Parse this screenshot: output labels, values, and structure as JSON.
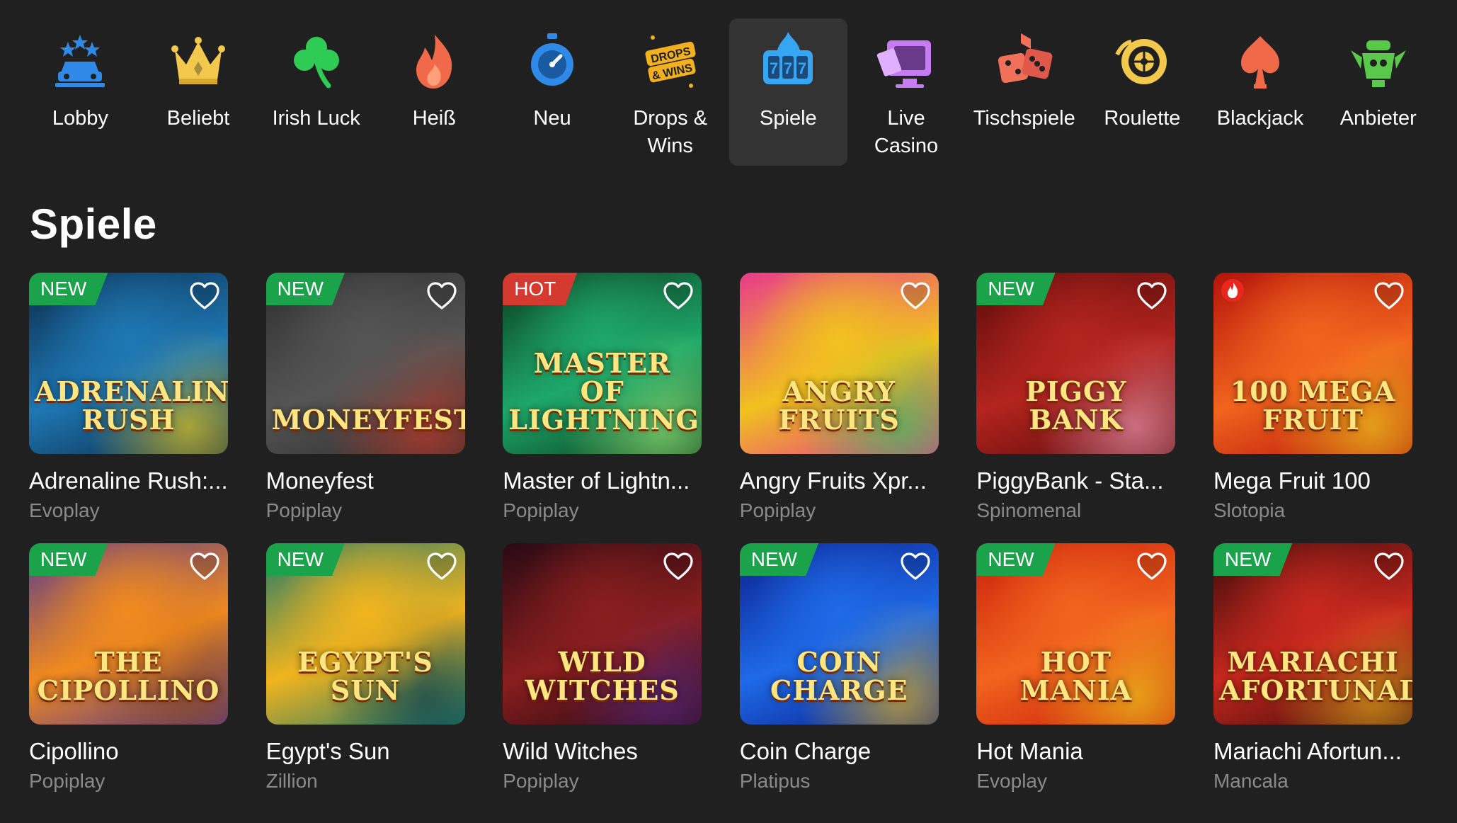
{
  "nav": {
    "items": [
      {
        "label": "Lobby",
        "icon": "lobby-car-icon",
        "color": "#2e8ae6"
      },
      {
        "label": "Beliebt",
        "icon": "crown-icon",
        "color": "#f2c94c"
      },
      {
        "label": "Irish Luck",
        "icon": "clover-icon",
        "color": "#2ecc55"
      },
      {
        "label": "Heiß",
        "icon": "flame-icon",
        "color": "#f06a4a"
      },
      {
        "label": "Neu",
        "icon": "stopwatch-icon",
        "color": "#2e8ae6"
      },
      {
        "label": "Drops &\nWins",
        "icon": "drops-wins-icon",
        "color": "#f2b01e"
      },
      {
        "label": "Spiele",
        "icon": "slot-777-icon",
        "color": "#36a6f2",
        "active": true
      },
      {
        "label": "Live\nCasino",
        "icon": "live-casino-icon",
        "color": "#c77bf2"
      },
      {
        "label": "Tischspiele",
        "icon": "dice-icon",
        "color": "#f0705a"
      },
      {
        "label": "Roulette",
        "icon": "roulette-icon",
        "color": "#f2c94c"
      },
      {
        "label": "Blackjack",
        "icon": "blackjack-spade-icon",
        "color": "#f06a4a"
      },
      {
        "label": "Anbieter",
        "icon": "provider-icon",
        "color": "#5ac84a"
      }
    ]
  },
  "section": {
    "title": "Spiele"
  },
  "games": [
    {
      "name": "Adrenaline Rush:...",
      "provider": "Evoplay",
      "badge": "NEW",
      "art_title": "ADRENALINE RUSH",
      "colors": [
        "#0b2a4a",
        "#1e78b4",
        "#f2d21e"
      ]
    },
    {
      "name": "Moneyfest",
      "provider": "Popiplay",
      "badge": "NEW",
      "art_title": "MONEYFEST",
      "colors": [
        "#2e2e2e",
        "#555555",
        "#d23a2a"
      ]
    },
    {
      "name": "Master of Lightn...",
      "provider": "Popiplay",
      "badge": "HOT",
      "art_title": "MASTER OF LIGHTNING",
      "colors": [
        "#0a3a1e",
        "#1ea86a",
        "#9cf27a"
      ]
    },
    {
      "name": "Angry Fruits Xpr...",
      "provider": "Popiplay",
      "badge": "",
      "art_title": "ANGRY FRUITS",
      "colors": [
        "#e83a8a",
        "#f2c21e",
        "#2ec85a"
      ]
    },
    {
      "name": "PiggyBank - Sta...",
      "provider": "Spinomenal",
      "badge": "NEW",
      "art_title": "PIGGY BANK",
      "colors": [
        "#5a0a0a",
        "#b4241e",
        "#f29ab4"
      ]
    },
    {
      "name": "Mega Fruit 100",
      "provider": "Slotopia",
      "badge": "hot-flag",
      "art_title": "100 MEGA FRUIT",
      "colors": [
        "#b4140a",
        "#f2641e",
        "#f2d21e"
      ]
    },
    {
      "name": "Cipollino",
      "provider": "Popiplay",
      "badge": "NEW",
      "art_title": "THE CIPOLLINO",
      "colors": [
        "#5a3a8a",
        "#f28a1e",
        "#8a4a1e"
      ]
    },
    {
      "name": "Egypt's Sun",
      "provider": "Zillion",
      "badge": "NEW",
      "art_title": "EGYPT'S SUN",
      "colors": [
        "#1e7a6a",
        "#f2b41e",
        "#0a3a4a"
      ]
    },
    {
      "name": "Wild Witches",
      "provider": "Popiplay",
      "badge": "",
      "art_title": "WILD WITCHES",
      "colors": [
        "#2a0a14",
        "#8a1e1e",
        "#5a2a8a"
      ]
    },
    {
      "name": "Coin Charge",
      "provider": "Platipus",
      "badge": "NEW",
      "art_title": "COIN CHARGE",
      "colors": [
        "#0a1e8a",
        "#1e6ae8",
        "#f2c21e"
      ]
    },
    {
      "name": "Hot Mania",
      "provider": "Evoplay",
      "badge": "NEW",
      "art_title": "HOT MANIA",
      "colors": [
        "#c81e0a",
        "#f2641e",
        "#f2d21e"
      ]
    },
    {
      "name": "Mariachi Afortun...",
      "provider": "Mancala",
      "badge": "NEW",
      "art_title": "MARIACHI AFORTUNADO",
      "colors": [
        "#3a0a0a",
        "#c8281e",
        "#f2b41e"
      ]
    }
  ]
}
